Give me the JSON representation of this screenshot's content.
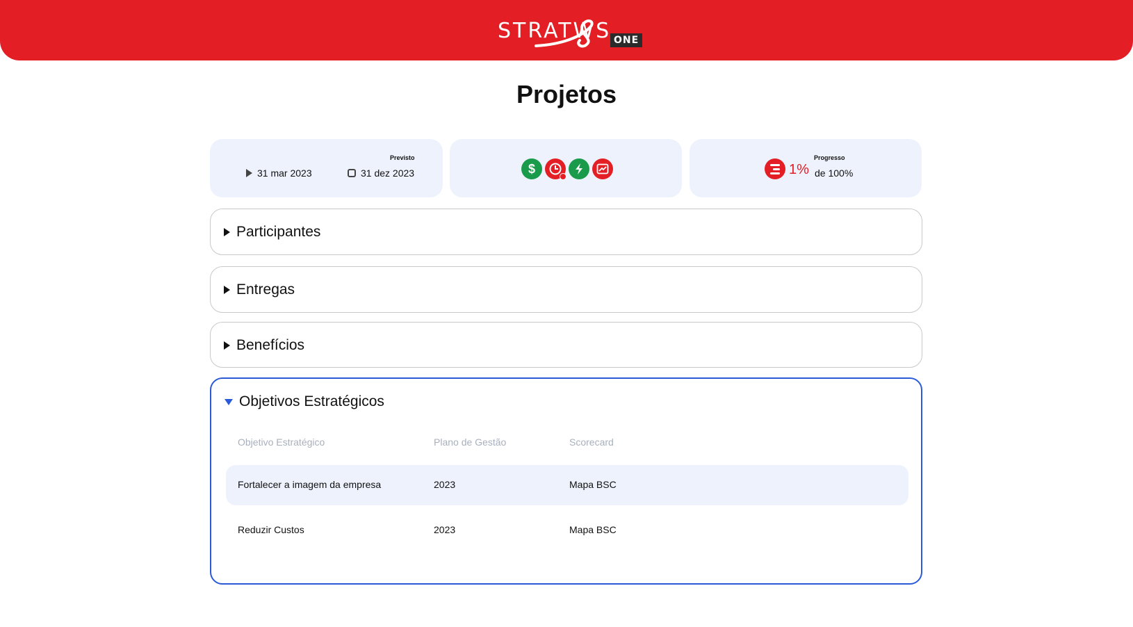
{
  "header": {
    "logo_text": "STRATWS",
    "logo_badge": "ONE",
    "brand_color": "#e31e24"
  },
  "page": {
    "title": "Projetos"
  },
  "dates_card": {
    "previsto_label": "Previsto",
    "start_date": "31 mar 2023",
    "end_date": "31 dez 2023"
  },
  "status_card": {
    "icons": [
      {
        "name": "dollar-icon",
        "glyph": "$",
        "color": "#1a9a4b"
      },
      {
        "name": "clock-icon",
        "glyph": "◷",
        "color": "#e31e24"
      },
      {
        "name": "lightning-icon",
        "glyph": "⚡",
        "color": "#1a9a4b"
      },
      {
        "name": "trend-chart-icon",
        "glyph": "↗",
        "color": "#e31e24"
      }
    ]
  },
  "progress_card": {
    "label": "Progresso",
    "value": "1%",
    "of_label": "de 100%",
    "progress_fraction": 0.01
  },
  "sections": {
    "participantes": "Participantes",
    "entregas": "Entregas",
    "beneficios": "Benefícios",
    "objetivos": "Objetivos Estratégicos"
  },
  "objetivos_table": {
    "columns": [
      "Objetivo Estratégico",
      "Plano de Gestão",
      "Scorecard"
    ],
    "rows": [
      {
        "objetivo": "Fortalecer a imagem da empresa",
        "plano": "2023",
        "scorecard": "Mapa BSC"
      },
      {
        "objetivo": "Reduzir Custos",
        "plano": "2023",
        "scorecard": "Mapa BSC"
      }
    ]
  }
}
